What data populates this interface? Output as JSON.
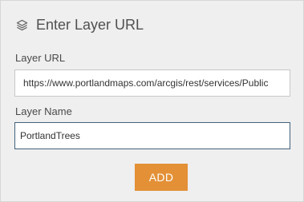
{
  "header": {
    "icon": "layers-icon",
    "title": "Enter Layer URL"
  },
  "form": {
    "url_label": "Layer URL",
    "url_value": "https://www.portlandmaps.com/arcgis/rest/services/Public",
    "name_label": "Layer Name",
    "name_value": "PortlandTrees"
  },
  "actions": {
    "add_label": "ADD"
  },
  "colors": {
    "panel_background": "#efefef",
    "accent_button": "#e39036",
    "focused_border": "#42617c"
  }
}
